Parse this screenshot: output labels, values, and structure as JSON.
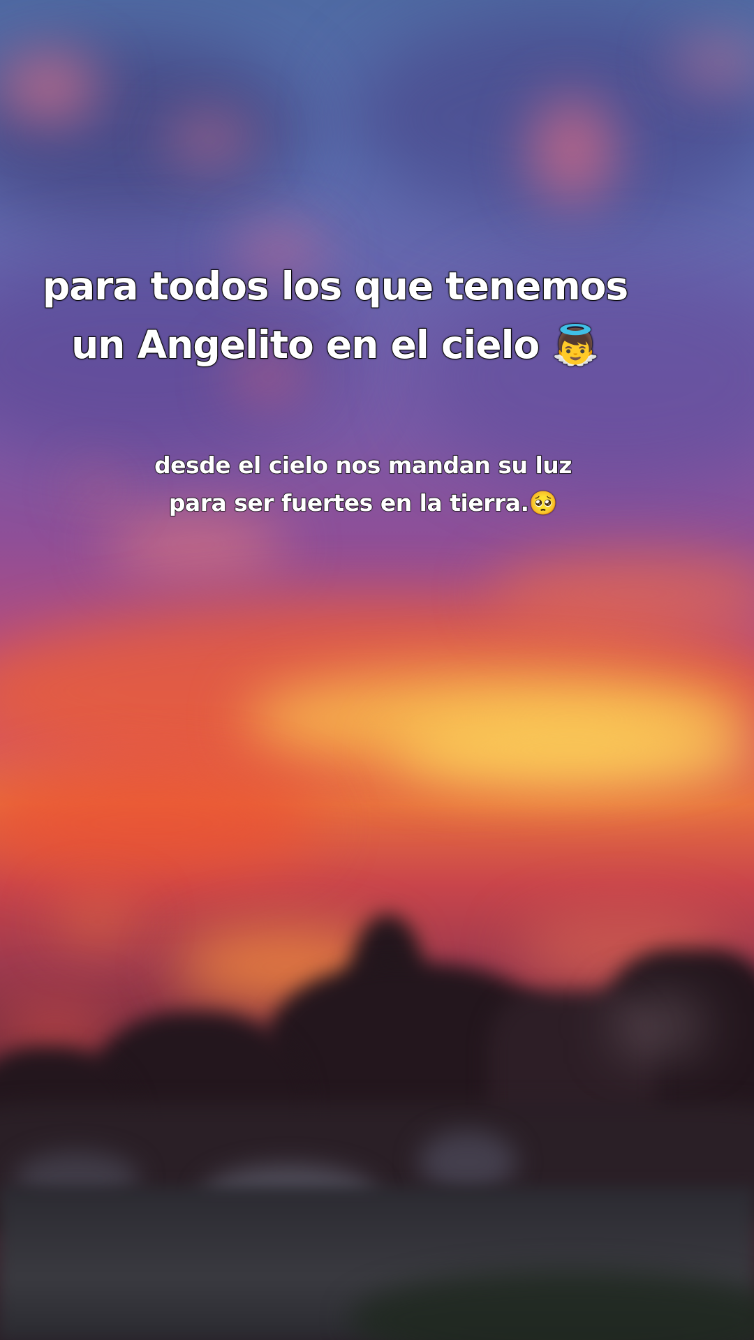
{
  "overlay_text": {
    "headline": {
      "line1": "para todos los que tenemos",
      "line2": "un Angelito en el cielo 👼"
    },
    "subline": {
      "line1": "desde el cielo nos mandan su luz",
      "line2": "para ser fuertes  en la tierra.🥺"
    }
  },
  "background": {
    "scene": "blurred-sunset-sky-over-houses",
    "colors": {
      "sky_top": "#4f6aa3",
      "sky_mid": "#8e4f98",
      "glow": "#f2b24a",
      "horizon": "#e8703f",
      "silhouette": "#23161d"
    }
  }
}
